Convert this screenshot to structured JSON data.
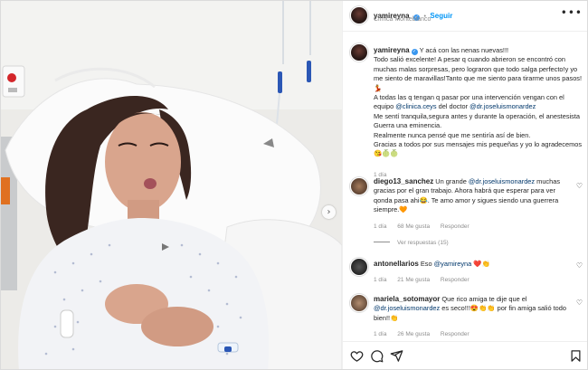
{
  "header": {
    "username": "yamireyna",
    "location": "Clínica Monteblanco",
    "follow_label": "Seguir",
    "separator": "•",
    "more_icon": "more-horizontal-icon"
  },
  "photo": {
    "alt_description": "post-image",
    "next_icon": "chevron-right-icon"
  },
  "caption": {
    "username": "yamireyna",
    "line1": "Y acá con las nenas nuevas!!!",
    "para1": "Todo salió excelente! A pesar q cuando abrieron se encontró con muchas malas sorpresas, pero lograron que todo salga perfecto!y yo me siento de maravillas!Tanto que me siento para tirarme unos pasos!💃",
    "para2_a": "A todas las q tengan q pasar por una intervención vengan con el equipo ",
    "para2_mention1": "@clinica.ceys",
    "para2_b": " del doctor ",
    "para2_mention2": "@dr.joseluismonardez",
    "para3": "Me sentí tranquila,segura antes y durante la operación, el anestesista Guerra una eminencia.",
    "para4": "Realmente nunca pensé que me sentiría así de bien.",
    "para5": "Gracias a todos por sus mensajes mis pequeñas y yo lo agradecemos😘🍈🍈",
    "time": "1 día"
  },
  "comments": [
    {
      "username": "diego13_sanchez",
      "text_a": " Un grande ",
      "mention": "@dr.joseluismonardez",
      "text_b": " muchas gracias por el gran trabajo. Ahora habrá que esperar para ver qonda pasa ahi😂. Te amo amor y sigues siendo una guerrera siempre.🧡",
      "time": "1 día",
      "likes": "68 Me gusta",
      "reply_label": "Responder",
      "view_replies": "Ver respuestas (15)"
    },
    {
      "username": "antonellarios",
      "text_a": " Eso ",
      "mention": "@yamireyna",
      "text_b": " ❤️👏",
      "time": "1 día",
      "likes": "21 Me gusta",
      "reply_label": "Responder"
    },
    {
      "username": "mariela_sotomayor",
      "text_a": " Que rico amiga te dije que el ",
      "mention": "@dr.joseluismonardez",
      "text_b": " es seco!!!😍👏👏 por fin amiga salió todo bien!!👏",
      "time": "1 día",
      "likes": "26 Me gusta",
      "reply_label": "Responder"
    }
  ],
  "actions": {
    "like_icon": "heart-icon",
    "comment_icon": "comment-icon",
    "share_icon": "share-icon",
    "save_icon": "bookmark-icon"
  },
  "colors": {
    "link_blue": "#0095f6",
    "mention": "#00376b",
    "muted": "#8e8e8e",
    "verified": "#3897f0"
  }
}
